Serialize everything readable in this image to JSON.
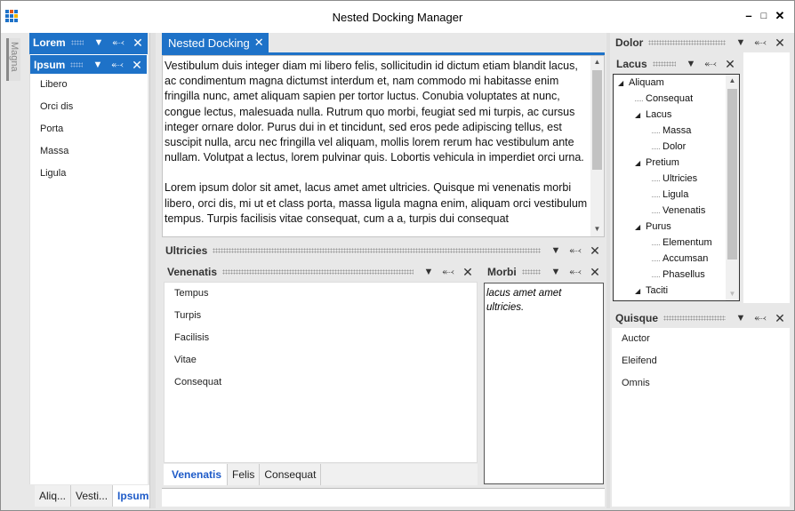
{
  "window": {
    "title": "Nested Docking Manager"
  },
  "side_tab": {
    "label": "Magna"
  },
  "left_outer": {
    "title": "Lorem"
  },
  "left_inner": {
    "title": "Ipsum",
    "items": [
      "Libero",
      "Orci dis",
      "Porta",
      "Massa",
      "Ligula"
    ]
  },
  "left_tabs": [
    "Aliq...",
    "Vesti...",
    "Ipsum"
  ],
  "document": {
    "tab_label": "Nested Docking",
    "paragraph1": "Vestibulum duis integer diam mi libero felis, sollicitudin id dictum etiam blandit lacus, ac condimentum magna dictumst interdum et, nam commodo mi habitasse enim fringilla nunc, amet aliquam sapien per tortor luctus. Conubia voluptates at nunc, congue lectus, malesuada nulla. Rutrum quo morbi, feugiat sed mi turpis, ac cursus integer ornare dolor. Purus dui in et tincidunt, sed eros pede adipiscing tellus, est suscipit nulla, arcu nec fringilla vel aliquam, mollis lorem rerum hac vestibulum ante nullam. Volutpat a lectus, lorem pulvinar quis. Lobortis vehicula in imperdiet orci urna.",
    "paragraph2": "Lorem ipsum dolor sit amet, lacus amet amet ultricies. Quisque mi venenatis morbi libero, orci dis, mi ut et class porta, massa ligula magna enim, aliquam orci vestibulum tempus. Turpis facilisis vitae consequat, cum a a, turpis dui consequat"
  },
  "ultricies": {
    "title": "Ultricies"
  },
  "venenatis": {
    "title": "Venenatis",
    "items": [
      "Tempus",
      "Turpis",
      "Facilisis",
      "Vitae",
      "Consequat"
    ],
    "tabs": [
      "Venenatis",
      "Felis",
      "Consequat"
    ]
  },
  "morbi": {
    "title": "Morbi",
    "text": "lacus amet amet ultricies."
  },
  "dolor": {
    "title": "Dolor"
  },
  "lacus": {
    "title": "Lacus",
    "tree": [
      {
        "label": "Aliquam",
        "level": 0,
        "expanded": true
      },
      {
        "label": "Consequat",
        "level": 1,
        "expanded": null
      },
      {
        "label": "Lacus",
        "level": 1,
        "expanded": true
      },
      {
        "label": "Massa",
        "level": 2,
        "expanded": null
      },
      {
        "label": "Dolor",
        "level": 2,
        "expanded": null
      },
      {
        "label": "Pretium",
        "level": 1,
        "expanded": true
      },
      {
        "label": "Ultricies",
        "level": 2,
        "expanded": null
      },
      {
        "label": "Ligula",
        "level": 2,
        "expanded": null
      },
      {
        "label": "Venenatis",
        "level": 2,
        "expanded": null
      },
      {
        "label": "Purus",
        "level": 1,
        "expanded": true
      },
      {
        "label": "Elementum",
        "level": 2,
        "expanded": null
      },
      {
        "label": "Accumsan",
        "level": 2,
        "expanded": null
      },
      {
        "label": "Phasellus",
        "level": 2,
        "expanded": null
      },
      {
        "label": "Taciti",
        "level": 1,
        "expanded": true
      }
    ]
  },
  "quisque": {
    "title": "Quisque",
    "items": [
      "Auctor",
      "Eleifend",
      "Omnis"
    ]
  },
  "colors": {
    "accent": "#1e72c8",
    "selected_tab_text": "#1e5bc8"
  }
}
